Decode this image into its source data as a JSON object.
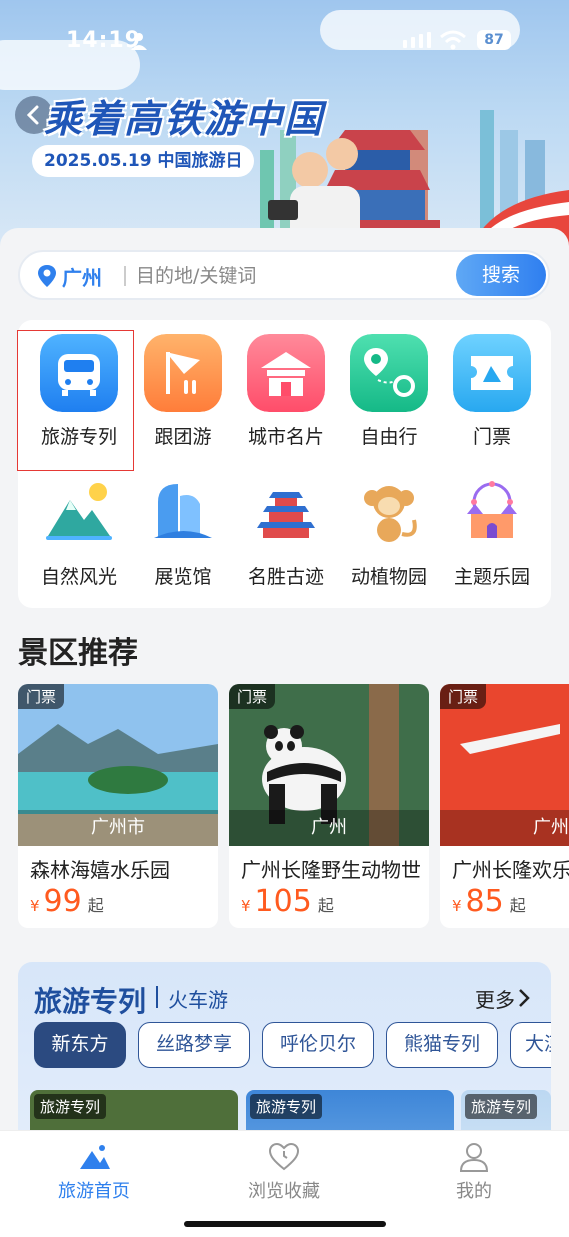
{
  "status_bar": {
    "time": "14:19",
    "battery": "87"
  },
  "banner": {
    "title": "乘着高铁游中国",
    "date_badge": "2025.05.19 中国旅游日"
  },
  "search": {
    "city": "广州",
    "placeholder": "目的地/关键词",
    "button": "搜索"
  },
  "categories": [
    {
      "label": "旅游专列",
      "icon": "train-icon"
    },
    {
      "label": "跟团游",
      "icon": "flag-icon"
    },
    {
      "label": "城市名片",
      "icon": "building-icon"
    },
    {
      "label": "自由行",
      "icon": "route-icon"
    },
    {
      "label": "门票",
      "icon": "ticket-icon"
    },
    {
      "label": "自然风光",
      "icon": "mountain-icon"
    },
    {
      "label": "展览馆",
      "icon": "museum-icon"
    },
    {
      "label": "名胜古迹",
      "icon": "temple-icon"
    },
    {
      "label": "动植物园",
      "icon": "monkey-icon"
    },
    {
      "label": "主题乐园",
      "icon": "castle-icon"
    }
  ],
  "scenic": {
    "title": "景区推荐",
    "items": [
      {
        "tag": "门票",
        "city": "广州市",
        "name": "森林海嬉水乐园",
        "currency": "¥",
        "price": "99",
        "suffix": "起"
      },
      {
        "tag": "门票",
        "city": "广州",
        "name": "广州长隆野生动物世",
        "currency": "¥",
        "price": "105",
        "suffix": "起"
      },
      {
        "tag": "门票",
        "city": "广州",
        "name": "广州长隆欢乐",
        "currency": "¥",
        "price": "85",
        "suffix": "起"
      }
    ]
  },
  "tourist_train": {
    "title": "旅游专列",
    "subtitle": "火车游",
    "more": "更多",
    "chips": [
      "新东方",
      "丝路梦享",
      "呼伦贝尔",
      "熊猫专列",
      "大漠"
    ],
    "thumb_tag": "旅游专列"
  },
  "bottom_nav": [
    {
      "label": "旅游首页",
      "icon": "home-mountain-icon"
    },
    {
      "label": "浏览收藏",
      "icon": "heart-clock-icon"
    },
    {
      "label": "我的",
      "icon": "user-icon"
    }
  ],
  "colors": {
    "accent": "#2f80ed",
    "price": "#ff5a1f",
    "highlight": "#e53935"
  }
}
